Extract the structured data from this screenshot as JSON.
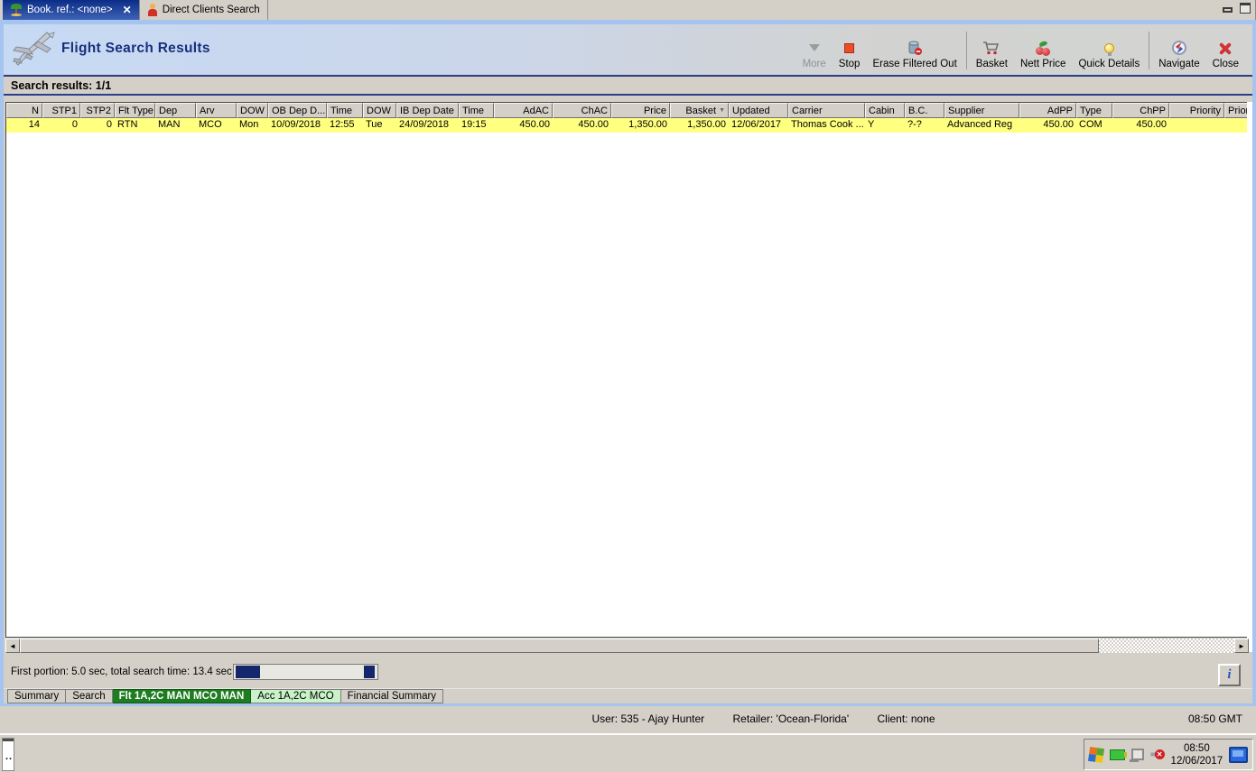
{
  "window": {
    "tabs": [
      {
        "label": "Book. ref.: <none>",
        "icon": "palm-tree",
        "closable": true
      },
      {
        "label": "Direct Clients Search",
        "icon": "person",
        "closable": false
      }
    ]
  },
  "header": {
    "title": "Flight Search Results"
  },
  "toolbar": {
    "more": "More",
    "stop": "Stop",
    "erase_filtered_out": "Erase Filtered Out",
    "basket": "Basket",
    "nett_price": "Nett Price",
    "quick_details": "Quick Details",
    "navigate": "Navigate",
    "close": "Close"
  },
  "results": {
    "label": "Search results: 1/1"
  },
  "table": {
    "columns": [
      "N",
      "STP1",
      "STP2",
      "Flt Type",
      "Dep",
      "Arv",
      "DOW",
      "OB Dep D...",
      "Time",
      "DOW",
      "IB Dep Date",
      "Time",
      "AdAC",
      "ChAC",
      "Price",
      "Basket",
      "Updated",
      "Carrier",
      "Cabin",
      "B.C.",
      "Supplier",
      "AdPP",
      "Type",
      "ChPP",
      "Priority",
      "Prior"
    ],
    "sorted_column": "Basket",
    "row": [
      "14",
      "0",
      "0",
      "RTN",
      "MAN",
      "MCO",
      "Mon",
      "10/09/2018",
      "12:55",
      "Tue",
      "24/09/2018",
      "19:15",
      "450.00",
      "450.00",
      "1,350.00",
      "1,350.00",
      "12/06/2017",
      "Thomas Cook ...",
      "Y",
      "?-?",
      "Advanced Reg",
      "450.00",
      "COM",
      "450.00",
      "",
      ""
    ],
    "row_highlight_color": "#ffff80"
  },
  "progress": {
    "label": "First portion: 5.0 sec, total search time: 13.4 sec",
    "bar_color": "#14276d"
  },
  "info_button": {
    "label": "i"
  },
  "bottom_tabs": [
    {
      "label": "Summary",
      "state": "normal"
    },
    {
      "label": "Search",
      "state": "normal"
    },
    {
      "label": "Flt 1A,2C MAN MCO MAN",
      "state": "selected-dark-green"
    },
    {
      "label": "Acc 1A,2C MCO",
      "state": "selected-light-green"
    },
    {
      "label": "Financial Summary",
      "state": "normal"
    }
  ],
  "statusbar": {
    "user": "User: 535 - Ajay Hunter",
    "retailer": "Retailer: 'Ocean-Florida'",
    "client": "Client: none",
    "gmt": "08:50 GMT"
  },
  "taskbar": {
    "handle": "..",
    "tray_time": "08:50",
    "tray_date": "12/06/2017"
  },
  "colors": {
    "active_tab_navy": "#0c2d87",
    "window_border_blue": "#a5c4ef",
    "row_yellow": "#ffff80",
    "tab_green_dark": "#1d7d20",
    "tab_green_light": "#c9f2c9",
    "title_navy": "#17307e",
    "chrome_gray": "#d4d0c8"
  }
}
